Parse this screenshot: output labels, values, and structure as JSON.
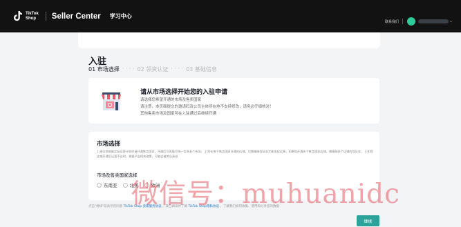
{
  "header": {
    "logo_text_line1": "TikTok",
    "logo_text_line2": "Shop",
    "brand": "Seller Center",
    "learning_center": "学习中心",
    "contact": "联系我们"
  },
  "page": {
    "title": "入驻",
    "steps": [
      {
        "label": "01 市场选择",
        "active": true
      },
      {
        "label": "02 领资认证",
        "active": false
      },
      {
        "label": "03 基础信息",
        "active": false
      }
    ],
    "step_separator": "· · · ·"
  },
  "welcome": {
    "title": "请从市场选择开始您的入驻申请",
    "lines": [
      "请选择您希望开通的市场及售卖国家",
      "请注意，本页面提交的邀请码及公司主体所在地不支持修改，请务必仔细核对！",
      "其他售卖市场及国家可在入驻通过后继续开通"
    ]
  },
  "market": {
    "title": "市场选择",
    "description": "1.建议您根据实际运营计划申请开通售卖国家，开通后可再填写统一信息多个市场； 2.您在每个售卖国家开通的店铺，均需缴纳保证金才能发起运营，如果您开通多个售卖国家店铺，需缴纳多个店铺的保证金； 3.如您店铺开通后运营不佳时，根据平台相关政策，可能会被关店清退",
    "subtitle": "市场及售卖国家选择",
    "options": [
      "东南亚",
      "北美",
      "欧洲"
    ]
  },
  "agreement": {
    "prefix": "点击\"继续\"前表示您同意",
    "link1": "TikTok Shop 卖家服务协议",
    "middle": "，及已阅读并了解",
    "link2": "TikTok Shop隐私协议",
    "suffix": "，了解我们如何收集、使用和分享您的数据"
  },
  "continue_button": "继续",
  "watermark": "微信号：muhuanidc",
  "colors": {
    "topbar": "#121212",
    "accent": "#2ba29a",
    "link": "#1a73c7"
  }
}
